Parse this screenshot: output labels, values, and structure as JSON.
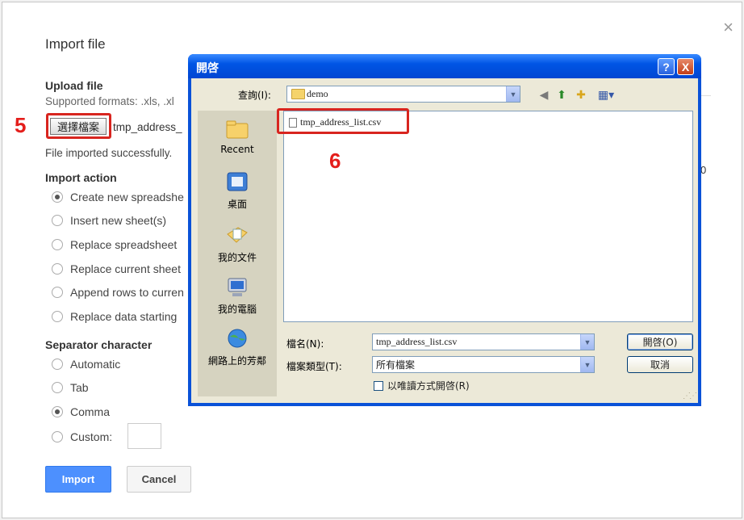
{
  "import_dialog": {
    "title": "Import file",
    "upload_heading": "Upload file",
    "supported_formats": "Supported formats: .xls, .xl",
    "choose_file_label": "選擇檔案",
    "chosen_file_name": "tmp_address_",
    "import_status": "File imported successfully.",
    "import_action_heading": "Import action",
    "import_actions": [
      {
        "label": "Create new spreadshe",
        "selected": true
      },
      {
        "label": "Insert new sheet(s)",
        "selected": false
      },
      {
        "label": "Replace spreadsheet",
        "selected": false
      },
      {
        "label": "Replace current sheet",
        "selected": false
      },
      {
        "label": "Append rows to curren",
        "selected": false
      },
      {
        "label": "Replace data starting",
        "selected": false
      }
    ],
    "separator_heading": "Separator character",
    "separators": [
      {
        "label": "Automatic",
        "selected": false
      },
      {
        "label": "Tab",
        "selected": false
      },
      {
        "label": "Comma",
        "selected": true
      },
      {
        "label": "Custom:",
        "selected": false
      }
    ],
    "import_button": "Import",
    "cancel_button": "Cancel",
    "close_glyph": "×",
    "background_digit": "0"
  },
  "annotations": {
    "step_5": "5",
    "step_6": "6",
    "highlight_color": "#d8251f"
  },
  "open_dialog": {
    "title": "開啓",
    "help_glyph": "?",
    "close_glyph": "X",
    "look_in_label": "查詢(I):",
    "look_in_value": "demo",
    "places": [
      {
        "label": "Recent",
        "icon": "recent-folder-icon"
      },
      {
        "label": "桌面",
        "icon": "desktop-icon"
      },
      {
        "label": "我的文件",
        "icon": "my-documents-icon"
      },
      {
        "label": "我的電腦",
        "icon": "my-computer-icon"
      },
      {
        "label": "網路上的芳鄰",
        "icon": "network-places-icon"
      }
    ],
    "files": [
      "tmp_address_list.csv"
    ],
    "file_name_label": "檔名(N):",
    "file_name_value": "tmp_address_list.csv",
    "file_type_label": "檔案類型(T):",
    "file_type_value": "所有檔案",
    "open_button": "開啓(O)",
    "cancel_button": "取消",
    "read_only_label": "以唯讀方式開啓(R)",
    "read_only_checked": false
  }
}
